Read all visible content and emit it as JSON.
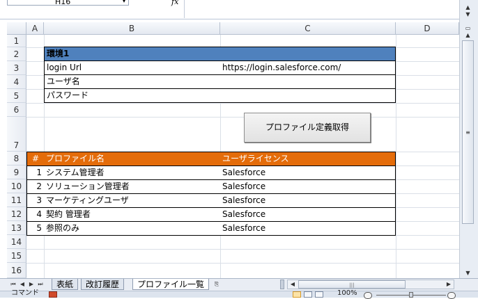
{
  "formula_bar": {
    "name_box_value": "H16",
    "fx_label": "fx"
  },
  "columns": [
    "A",
    "B",
    "C",
    "D"
  ],
  "rows": [
    "1",
    "2",
    "3",
    "4",
    "5",
    "6",
    "7",
    "8",
    "9",
    "10",
    "11",
    "12",
    "13",
    "14",
    "15",
    "16"
  ],
  "env": {
    "title": "環境1",
    "labels": [
      "login Url",
      "ユーザ名",
      "パスワード"
    ],
    "values": [
      "https://login.salesforce.com/",
      "",
      ""
    ]
  },
  "button": {
    "label": "プロファイル定義取得"
  },
  "table": {
    "headers": [
      "#",
      "プロファイル名",
      "ユーザライセンス"
    ],
    "rows": [
      [
        "1",
        "システム管理者",
        "Salesforce"
      ],
      [
        "2",
        "ソリューション管理者",
        "Salesforce"
      ],
      [
        "3",
        "マーケティングユーザ",
        "Salesforce"
      ],
      [
        "4",
        "契約 管理者",
        "Salesforce"
      ],
      [
        "5",
        "参照のみ",
        "Salesforce"
      ]
    ]
  },
  "sheet_tabs": [
    "表紙",
    "改訂履歴",
    "プロファイル一覧"
  ],
  "active_tab": "プロファイル一覧",
  "status": {
    "mode": "コマンド",
    "zoom": "100%"
  },
  "colors": {
    "header_blue": "#4f81bd",
    "header_orange": "#e46c0a"
  }
}
